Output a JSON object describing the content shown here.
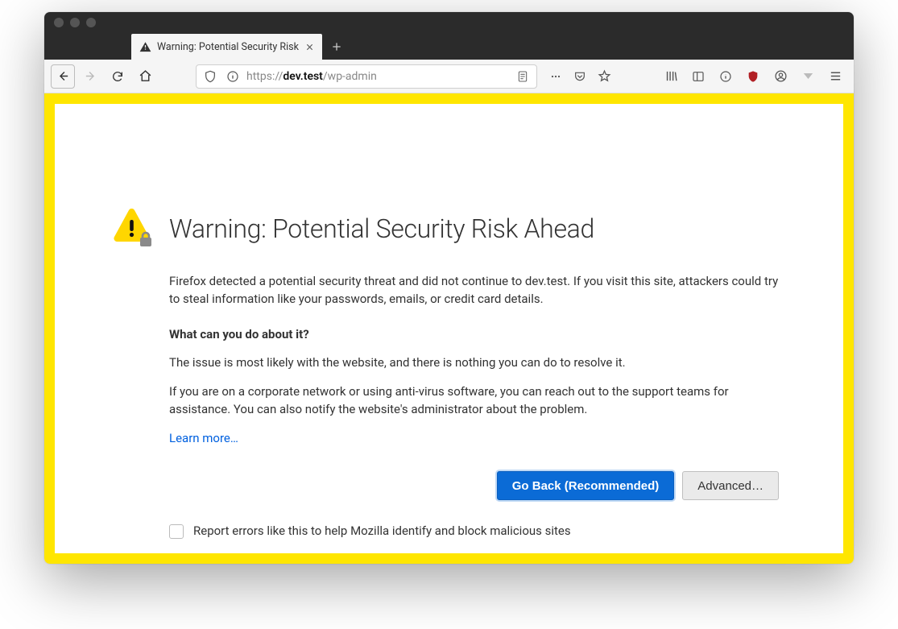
{
  "tab": {
    "title": "Warning: Potential Security Risk"
  },
  "urlbar": {
    "protocol": "https://",
    "domain": "dev.test",
    "path": "/wp-admin"
  },
  "warning": {
    "heading": "Warning: Potential Security Risk Ahead",
    "paragraph1": "Firefox detected a potential security threat and did not continue to dev.test. If you visit this site, attackers could try to steal information like your passwords, emails, or credit card details.",
    "subheading": "What can you do about it?",
    "paragraph2": "The issue is most likely with the website, and there is nothing you can do to resolve it.",
    "paragraph3": "If you are on a corporate network or using anti-virus software, you can reach out to the support teams for assistance. You can also notify the website's administrator about the problem.",
    "learn_more": "Learn more…",
    "go_back": "Go Back (Recommended)",
    "advanced": "Advanced…",
    "report_label": "Report errors like this to help Mozilla identify and block malicious sites"
  }
}
